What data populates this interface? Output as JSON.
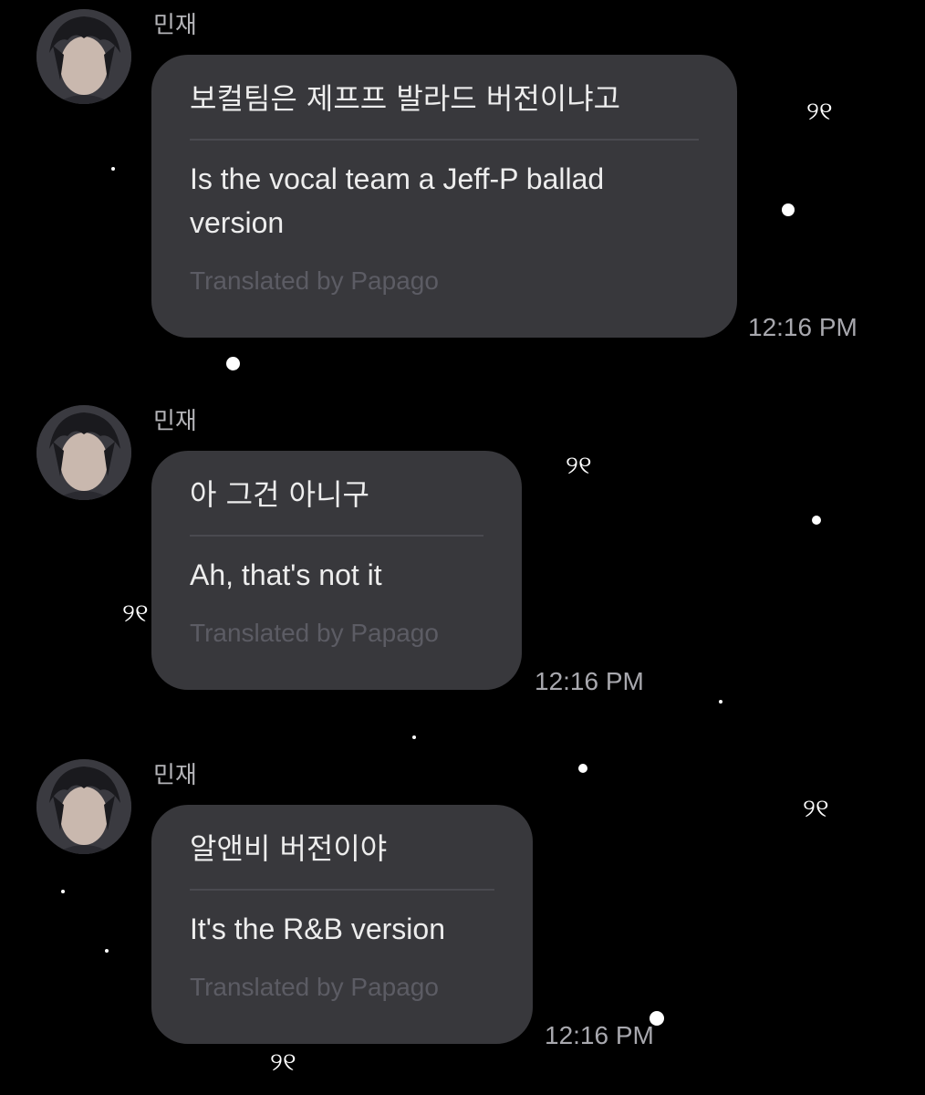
{
  "messages": [
    {
      "sender": "민재",
      "original": "보컬팀은 제프프 발라드 버전이냐고",
      "translation": "Is the vocal team a Jeff-P ballad version",
      "credit": "Translated by Papago",
      "time": "12:16 PM"
    },
    {
      "sender": "민재",
      "original": "아 그건 아니구",
      "translation": "Ah, that's not it",
      "credit": "Translated by Papago",
      "time": "12:16 PM"
    },
    {
      "sender": "민재",
      "original": "알앤비 버전이야",
      "translation": "It's the R&B version",
      "credit": "Translated by Papago",
      "time": "12:16 PM"
    }
  ],
  "theme": {
    "background": "#000000",
    "bubble": "#38383c",
    "text": "#ededed",
    "muted_text": "#5c5c64",
    "sender_text": "#b4b4b8"
  },
  "decorations": {
    "stars": "white-dot-icons",
    "ribbon_glyph": "୨୧"
  },
  "avatar": {
    "icon": "profile-photo"
  }
}
